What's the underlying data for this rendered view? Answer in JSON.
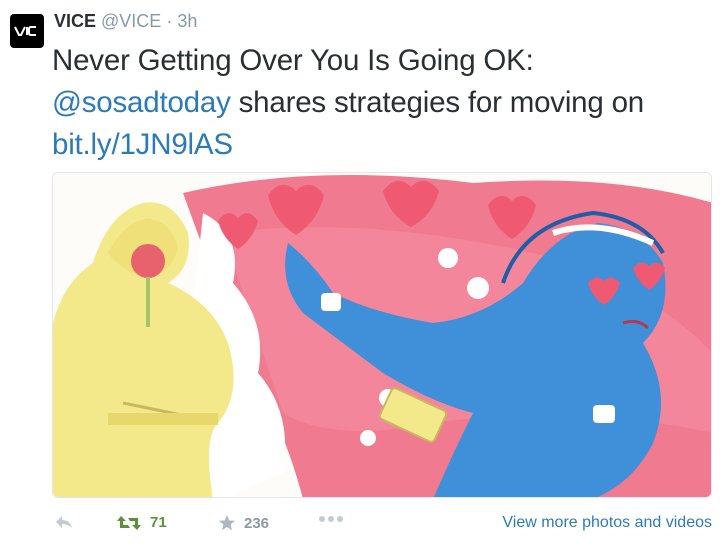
{
  "tweet": {
    "name": "VICE",
    "handle": "@VICE",
    "separator": "·",
    "time": "3h",
    "avatar_icon": "vice-logo-icon",
    "text": {
      "line1": "Never Getting Over You Is Going OK:",
      "mention": "@sosadtoday",
      "line2_rest": " shares strategies for moving on",
      "link": "bit.ly/1JN9lAS"
    },
    "media": {
      "description_icon": "illustration-image"
    },
    "actions": {
      "reply_icon": "reply-icon",
      "retweet_icon": "retweet-icon",
      "retweet_count": "71",
      "favorite_icon": "star-icon",
      "favorite_count": "236",
      "more_icon": "more-dots-icon",
      "view_more": "View more photos and videos"
    },
    "colors": {
      "link": "#2b7bb9",
      "retweet": "#5c913b",
      "muted": "#8899a6",
      "text": "#292f33"
    }
  }
}
